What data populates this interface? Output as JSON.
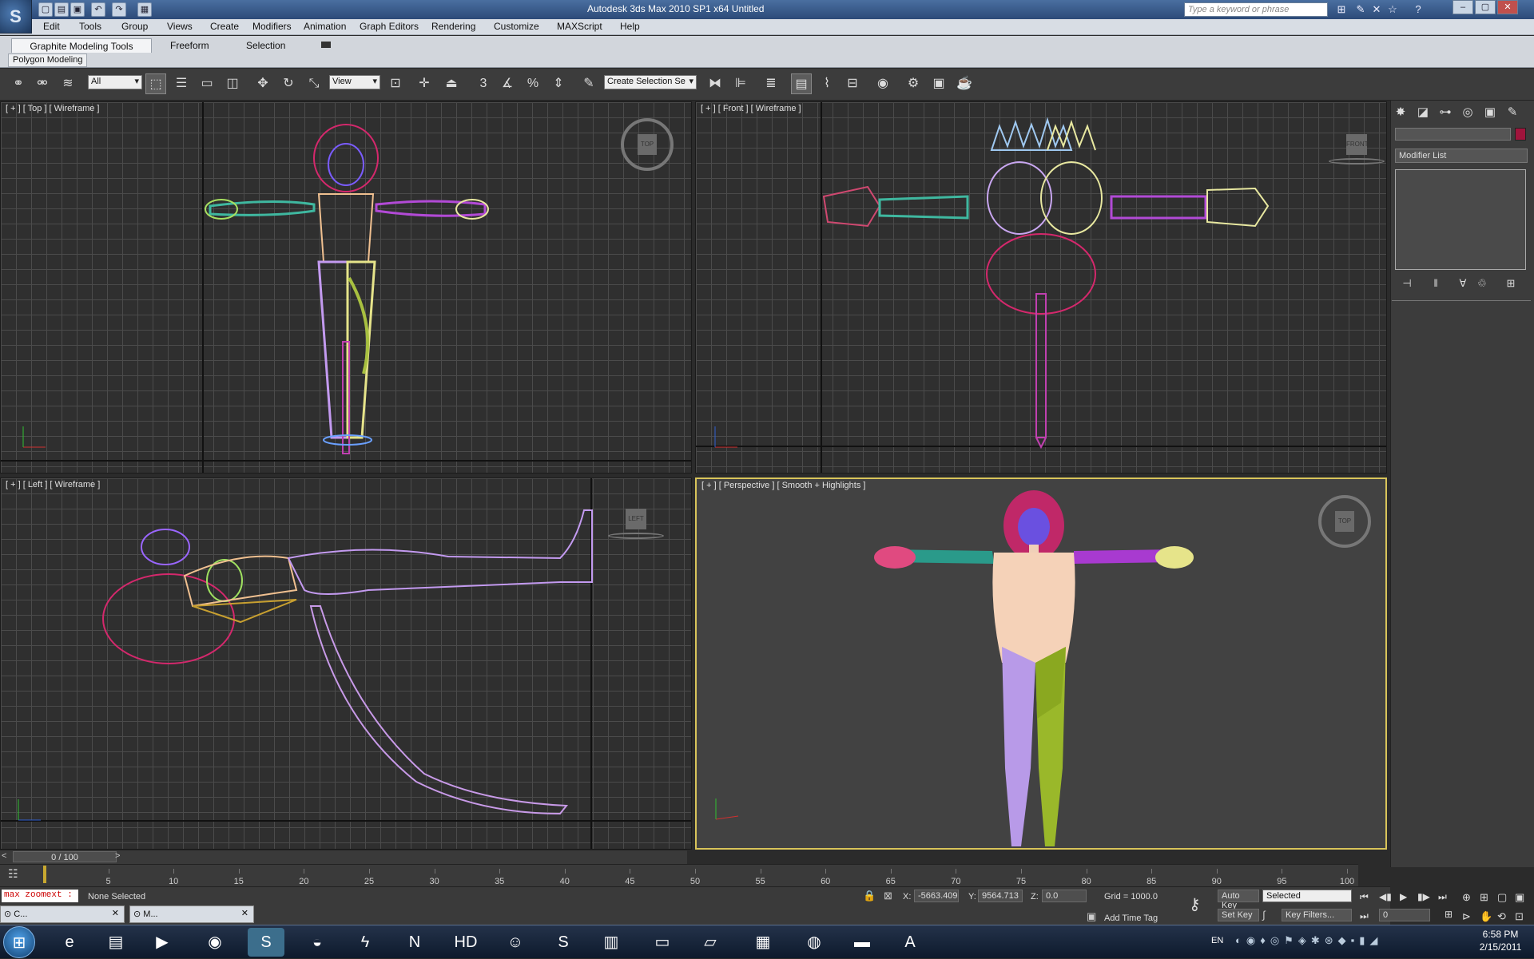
{
  "window": {
    "title": "Autodesk 3ds Max  2010 SP1 x64      Untitled",
    "help_placeholder": "Type a keyword or phrase"
  },
  "menu": [
    "Edit",
    "Tools",
    "Group",
    "Views",
    "Create",
    "Modifiers",
    "Animation",
    "Graph Editors",
    "Rendering",
    "Customize",
    "MAXScript",
    "Help"
  ],
  "ribbon": {
    "tabs": [
      "Graphite Modeling Tools",
      "Freeform",
      "Selection"
    ],
    "active_tab": "Graphite Modeling Tools",
    "panel": "Polygon Modeling"
  },
  "toolbar": {
    "filter_value": "All",
    "coord_value": "View",
    "selection_set_placeholder": "Create Selection Se"
  },
  "viewports": {
    "top": "[ + ] [ Top ] [ Wireframe ]",
    "front": "[ + ] [ Front ] [ Wireframe ]",
    "left": "[ + ] [ Left ] [ Wireframe ]",
    "perspective": "[ + ] [ Perspective ] [ Smooth + Highlights ]",
    "cube_top": "TOP",
    "cube_front": "FRONT",
    "cube_left": "LEFT"
  },
  "command_panel": {
    "modifier_list": "Modifier List"
  },
  "timeline": {
    "frame": "0 / 100",
    "ticks": [
      "5",
      "10",
      "15",
      "20",
      "25",
      "30",
      "35",
      "40",
      "45",
      "50",
      "55",
      "60",
      "65",
      "70",
      "75",
      "80",
      "85",
      "90",
      "95",
      "100"
    ]
  },
  "status": {
    "script_listener": "max zoomext :",
    "selection": "None Selected",
    "x_label": "X:",
    "x": "-5663.409",
    "y_label": "Y:",
    "y": "9564.713",
    "z_label": "Z:",
    "z": "0.0",
    "grid": "Grid = 1000.0",
    "add_time_tag": "Add Time Tag",
    "auto_key": "Auto Key",
    "set_key": "Set Key",
    "selected": "Selected",
    "key_filters": "Key Filters...",
    "frame_field": "0"
  },
  "mini_windows": [
    {
      "label": "C..."
    },
    {
      "label": "M..."
    }
  ],
  "taskbar": {
    "lang": "EN",
    "time": "6:58 PM",
    "date": "2/15/2011"
  }
}
